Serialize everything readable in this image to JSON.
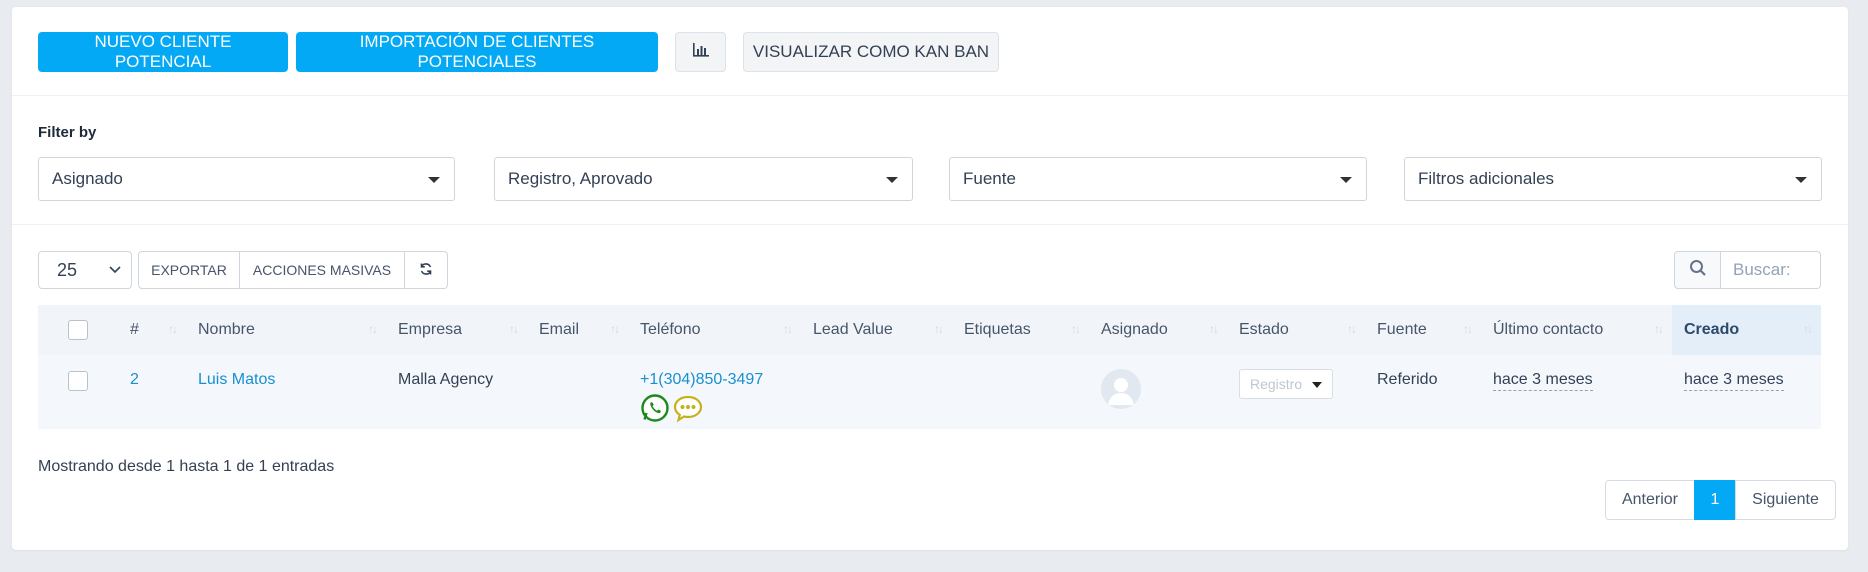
{
  "toolbar": {
    "new_lead": "NUEVO CLIENTE POTENCIAL",
    "import_leads": "IMPORTACIÓN DE CLIENTES POTENCIALES",
    "chart_icon": "bar-chart-icon",
    "kanban": "VISUALIZAR COMO KAN BAN"
  },
  "filters": {
    "label": "Filter by",
    "assigned": "Asignado",
    "status": "Registro, Aprovado",
    "source": "Fuente",
    "additional": "Filtros adicionales"
  },
  "table_controls": {
    "page_length": "25",
    "export": "EXPORTAR",
    "bulk_actions": "ACCIONES MASIVAS",
    "refresh_icon": "refresh-icon",
    "search_icon": "search-icon",
    "search_placeholder": "Buscar:"
  },
  "table": {
    "headers": [
      "#",
      "Nombre",
      "Empresa",
      "Email",
      "Teléfono",
      "Lead Value",
      "Etiquetas",
      "Asignado",
      "Estado",
      "Fuente",
      "Último contacto",
      "Creado"
    ],
    "rows": [
      {
        "id": "2",
        "name": "Luis Matos",
        "company": "Malla Agency",
        "email": "",
        "phone": "+1(304)850-3497",
        "lead_value": "",
        "tags": "",
        "status": "Registro",
        "source": "Referido",
        "last_contact": "hace 3 meses",
        "created": "hace 3 meses"
      }
    ]
  },
  "footer": {
    "info": "Mostrando desde 1 hasta 1 de 1 entradas",
    "prev": "Anterior",
    "page": "1",
    "next": "Siguiente"
  },
  "colors": {
    "primary": "#03a9f4",
    "link": "#1a8fcf",
    "whatsapp": "#1b8a1b",
    "sms": "#c5b21a"
  }
}
